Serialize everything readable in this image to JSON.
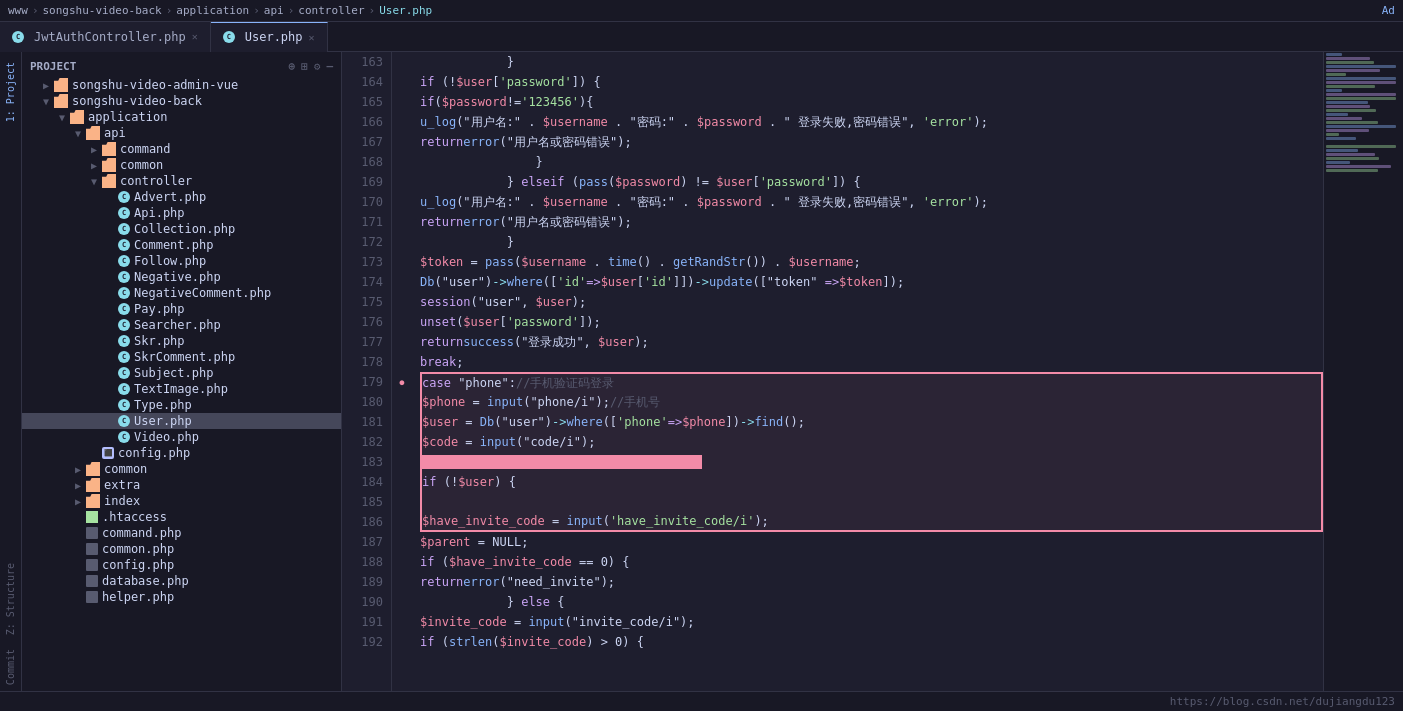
{
  "topbar": {
    "breadcrumbs": [
      "www",
      "songshu-video-back",
      "application",
      "api",
      "controller",
      "User.php"
    ]
  },
  "tabs": [
    {
      "id": "jwt",
      "label": "JwtAuthController.php",
      "active": false,
      "icon": "C"
    },
    {
      "id": "user",
      "label": "User.php",
      "active": true,
      "icon": "C"
    }
  ],
  "sidebar": {
    "title": "Project",
    "sections": [
      {
        "label": "1: Project",
        "items": [
          {
            "type": "folder",
            "label": "songshu-video-admin-vue",
            "depth": 1,
            "expanded": false
          },
          {
            "type": "folder",
            "label": "songshu-video-back",
            "depth": 1,
            "expanded": true
          },
          {
            "type": "folder",
            "label": "application",
            "depth": 2,
            "expanded": true
          },
          {
            "type": "folder",
            "label": "api",
            "depth": 3,
            "expanded": true
          },
          {
            "type": "folder",
            "label": "command",
            "depth": 4,
            "expanded": false
          },
          {
            "type": "folder",
            "label": "common",
            "depth": 4,
            "expanded": false
          },
          {
            "type": "folder",
            "label": "controller",
            "depth": 4,
            "expanded": true
          },
          {
            "type": "file-c",
            "label": "Advert.php",
            "depth": 5
          },
          {
            "type": "file-c",
            "label": "Api.php",
            "depth": 5
          },
          {
            "type": "file-c",
            "label": "Collection.php",
            "depth": 5
          },
          {
            "type": "file-c",
            "label": "Comment.php",
            "depth": 5
          },
          {
            "type": "file-c",
            "label": "Follow.php",
            "depth": 5
          },
          {
            "type": "file-c",
            "label": "Negative.php",
            "depth": 5
          },
          {
            "type": "file-c",
            "label": "NegativeComment.php",
            "depth": 5
          },
          {
            "type": "file-c",
            "label": "Pay.php",
            "depth": 5
          },
          {
            "type": "file-c",
            "label": "Searcher.php",
            "depth": 5
          },
          {
            "type": "file-c",
            "label": "Skr.php",
            "depth": 5
          },
          {
            "type": "file-c",
            "label": "SkrComment.php",
            "depth": 5
          },
          {
            "type": "file-c",
            "label": "Subject.php",
            "depth": 5
          },
          {
            "type": "file-c",
            "label": "TextImage.php",
            "depth": 5
          },
          {
            "type": "file-c",
            "label": "Type.php",
            "depth": 5
          },
          {
            "type": "file-c",
            "label": "User.php",
            "depth": 5,
            "selected": true
          },
          {
            "type": "file-c",
            "label": "Video.php",
            "depth": 5
          },
          {
            "type": "file-php",
            "label": "config.php",
            "depth": 4
          },
          {
            "type": "folder",
            "label": "common",
            "depth": 3,
            "expanded": false
          },
          {
            "type": "folder",
            "label": "extra",
            "depth": 3,
            "expanded": false
          },
          {
            "type": "folder",
            "label": "index",
            "depth": 3,
            "expanded": false
          },
          {
            "type": "file-htaccess",
            "label": ".htaccess",
            "depth": 3
          },
          {
            "type": "file-php",
            "label": "command.php",
            "depth": 3
          },
          {
            "type": "file-php",
            "label": "common.php",
            "depth": 3
          },
          {
            "type": "file-php",
            "label": "config.php",
            "depth": 3
          },
          {
            "type": "file-php",
            "label": "database.php",
            "depth": 3
          },
          {
            "type": "file-php",
            "label": "helper.php",
            "depth": 3
          }
        ]
      }
    ]
  },
  "code": {
    "lines": [
      {
        "num": 163,
        "content": "            }",
        "fold": false
      },
      {
        "num": 164,
        "content": "            if (!$user['password']) {",
        "fold": false
      },
      {
        "num": 165,
        "content": "                if($password!='123456'){",
        "fold": false
      },
      {
        "num": 166,
        "content": "                    u_log(\"用户名:\" . $username . \"密码:\" . $password . \" 登录失败,密码错误\", 'error');",
        "fold": false
      },
      {
        "num": 167,
        "content": "                    return error(\"用户名或密码错误\");",
        "fold": false
      },
      {
        "num": 168,
        "content": "                }",
        "fold": false
      },
      {
        "num": 169,
        "content": "            } elseif (pass($password) != $user['password']) {",
        "fold": false
      },
      {
        "num": 170,
        "content": "                u_log(\"用户名:\" . $username . \"密码:\" . $password . \" 登录失败,密码错误\", 'error');",
        "fold": false
      },
      {
        "num": 171,
        "content": "                return error(\"用户名或密码错误\");",
        "fold": false
      },
      {
        "num": 172,
        "content": "            }",
        "fold": false
      },
      {
        "num": 173,
        "content": "            $token = pass($username . time() . getRandStr()) . $username;",
        "fold": false
      },
      {
        "num": 174,
        "content": "            Db(\"user\")->where(['id' => $user['id']])->update([\"token\" => $token]);",
        "fold": false
      },
      {
        "num": 175,
        "content": "            session(\"user\", $user);",
        "fold": false
      },
      {
        "num": 176,
        "content": "            unset($user['password']);",
        "fold": false
      },
      {
        "num": 177,
        "content": "            return success(\"登录成功\", $user);",
        "fold": false
      },
      {
        "num": 178,
        "content": "            break;",
        "fold": false
      },
      {
        "num": 179,
        "content": "        case \"phone\"://手机验证码登录",
        "fold": true,
        "highlight_box_start": true
      },
      {
        "num": 180,
        "content": "            $phone = input(\"phone/i\");//手机号",
        "fold": false
      },
      {
        "num": 181,
        "content": "            $user = Db(\"user\")->where(['phone' => $phone])->find();",
        "fold": false
      },
      {
        "num": 182,
        "content": "            $code = input(\"code/i\");",
        "fold": false
      },
      {
        "num": 183,
        "content": "CURSOR_LINE",
        "fold": false
      },
      {
        "num": 184,
        "content": "            if (!$user) {",
        "fold": false
      },
      {
        "num": 185,
        "content": "",
        "fold": false
      },
      {
        "num": 186,
        "content": "                $have_invite_code = input('have_invite_code/i');",
        "fold": false,
        "highlight_box_end": true
      },
      {
        "num": 187,
        "content": "            $parent = NULL;",
        "fold": false
      },
      {
        "num": 188,
        "content": "            if ($have_invite_code == 0) {",
        "fold": false
      },
      {
        "num": 189,
        "content": "                return error(\"need_invite\");",
        "fold": false
      },
      {
        "num": 190,
        "content": "            } else {",
        "fold": false
      },
      {
        "num": 191,
        "content": "                $invite_code = input(\"invite_code/i\");",
        "fold": false
      },
      {
        "num": 192,
        "content": "            if (strlen($invite_code) > 0) {",
        "fold": false
      }
    ]
  },
  "statusbar": {
    "url": "https://blog.csdn.net/dujiangdu123"
  },
  "icons": {
    "arrow_right": "▶",
    "arrow_down": "▼",
    "fold_open": "▼",
    "fold_close": "▶",
    "project_icon": "📁",
    "settings": "⚙",
    "expand_all": "⊞",
    "collapse_all": "⊟"
  }
}
